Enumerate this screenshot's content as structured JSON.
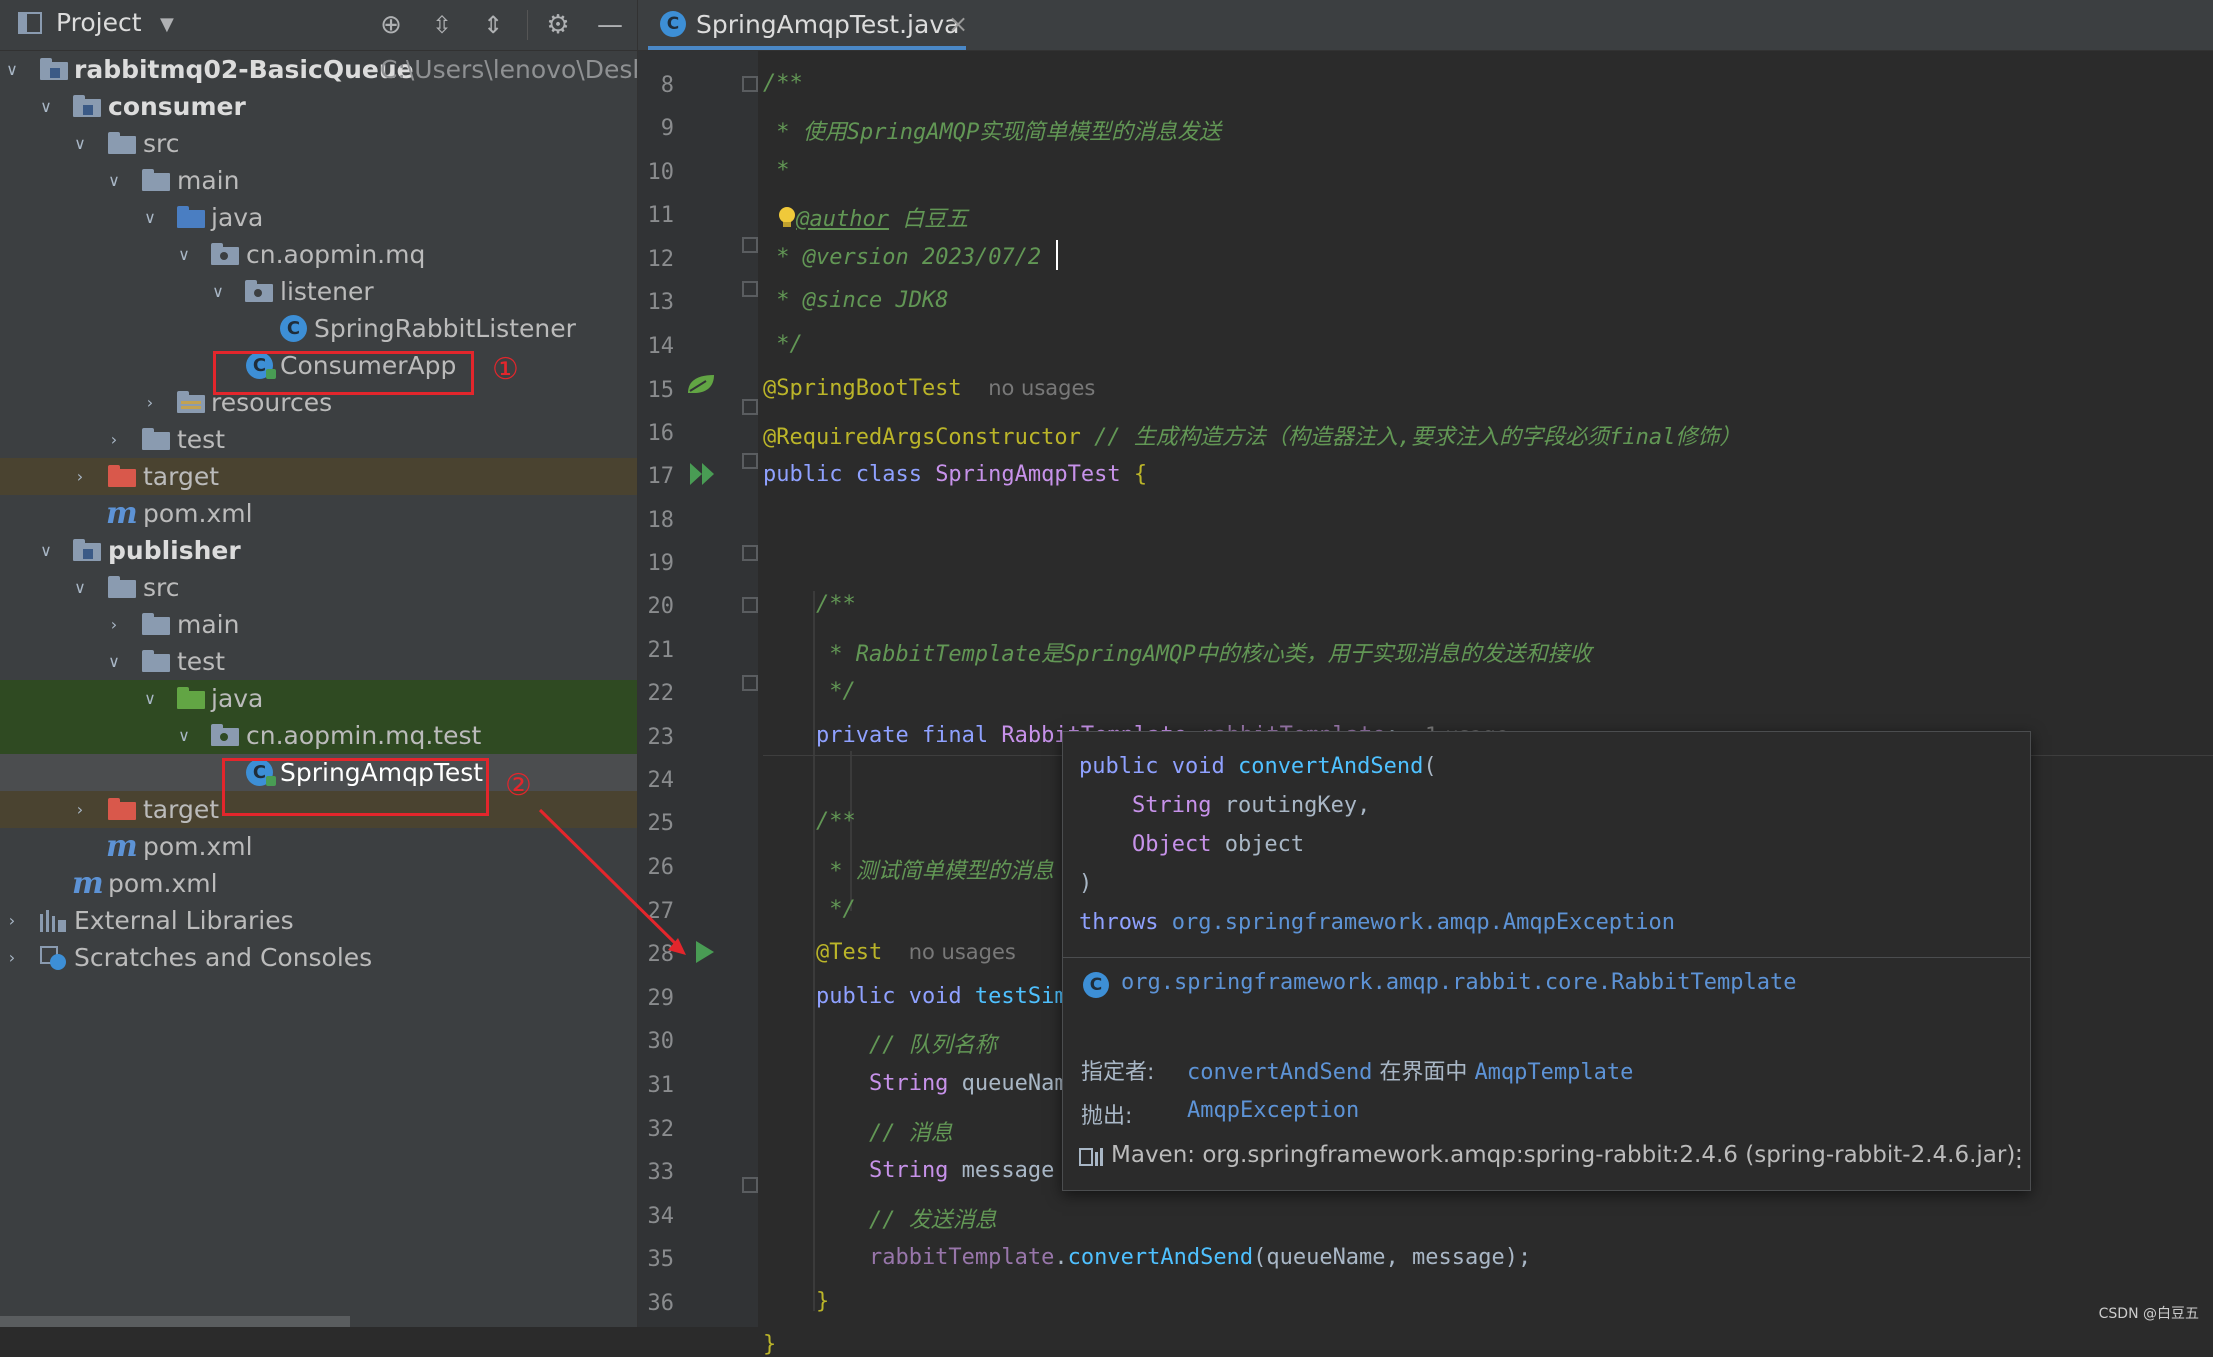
{
  "project_panel": {
    "title": "Project",
    "root_name": "rabbitmq02-BasicQueue",
    "root_path": "C:\\Users\\lenovo\\Deskt",
    "tree": {
      "consumer": "consumer",
      "consumer_src": "src",
      "consumer_main": "main",
      "consumer_java": "java",
      "consumer_pkg": "cn.aopmin.mq",
      "consumer_listener": "listener",
      "listener_class": "SpringRabbitListener",
      "consumer_app": "ConsumerApp",
      "consumer_resources": "resources",
      "consumer_test": "test",
      "consumer_target": "target",
      "consumer_pom": "pom.xml",
      "publisher": "publisher",
      "publisher_src": "src",
      "publisher_main": "main",
      "publisher_test": "test",
      "publisher_java": "java",
      "publisher_pkg": "cn.aopmin.mq.test",
      "publisher_test_class": "SpringAmqpTest",
      "publisher_target": "target",
      "publisher_pom": "pom.xml",
      "root_pom": "pom.xml",
      "external_libraries": "External Libraries",
      "scratches": "Scratches and Consoles"
    },
    "marker_1": "①",
    "marker_2": "②"
  },
  "editor": {
    "tab_title": "SpringAmqpTest.java",
    "tab_close": "×",
    "line_numbers": [
      "8",
      "9",
      "10",
      "11",
      "12",
      "13",
      "14",
      "15",
      "16",
      "17",
      "18",
      "19",
      "20",
      "21",
      "22",
      "23",
      "24",
      "25",
      "26",
      "27",
      "28",
      "29",
      "30",
      "31",
      "32",
      "33",
      "34",
      "35",
      "36"
    ],
    "lines": {
      "l8": "/**",
      "l9": " * 使用SpringAMQP实现简单模型的消息发送",
      "l10": " *",
      "l11_tag": "@author",
      "l11_val": " 白豆五",
      "l12_star": " * ",
      "l12_tag": "@version",
      "l12_val": " 2023/07/2",
      "l13_star": " * ",
      "l13_tag": "@since",
      "l13_val": " JDK8",
      "l14": " */",
      "l15_ann": "@SpringBootTest",
      "l15_hint": "no usages",
      "l16_ann": "@RequiredArgsConstructor",
      "l16_cm": " // 生成构造方法（构造器注入,要求注入的字段必须final修饰）",
      "l17_kw": "public class ",
      "l17_name": "SpringAmqpTest",
      "l17_rest": " {",
      "l19": "    /**",
      "l20": "     * RabbitTemplate是SpringAMQP中的核心类，用于实现消息的发送和接收",
      "l21": "     */",
      "l22_kw": "    private final ",
      "l22_type": "RabbitTemplate",
      "l22_field": " rabbitTemplate",
      "l22_end": ";",
      "l22_hint": "1 usage",
      "l24": "    /**",
      "l25": "     * 测试简单模型的消息",
      "l26": "     */",
      "l27_ann": "    @Test",
      "l27_hint": "no usages",
      "l28_kw": "    public void ",
      "l28_name": "testSim",
      "l29": "        // 队列名称",
      "l30_type": "        String",
      "l30_rest": " queueNam",
      "l31": "        // 消息",
      "l32_type": "        String",
      "l32_rest": " message",
      "l33": "        // 发送消息",
      "l34_field": "        rabbitTemplate",
      "l34_dot": ".",
      "l34_method": "convertAndSend",
      "l34_args": "(queueName, message);",
      "l35": "    }",
      "l36": "}"
    }
  },
  "popup": {
    "sig_line1_kw": "public void ",
    "sig_line1_name": "convertAndSend",
    "sig_line1_paren": "(",
    "sig_line2_type": "    String",
    "sig_line2_param": " routingKey,",
    "sig_line3_type": "    Object",
    "sig_line3_param": " object",
    "sig_line4": ")",
    "sig_line5_kw": "throws ",
    "sig_line5_exc": "org.springframework.amqp.AmqpException",
    "class_fqn": "org.springframework.amqp.rabbit.core.RabbitTemplate",
    "specified_label": "指定者:",
    "specified_method": "convertAndSend",
    "specified_mid": " 在界面中 ",
    "specified_iface": "AmqpTemplate",
    "throws_label": "抛出:",
    "throws_value": "AmqpException",
    "maven": "Maven: org.springframework.amqp:spring-rabbit:2.4.6 (spring-rabbit-2.4.6.jar)",
    "more": "⋮"
  },
  "watermark": "CSDN @白豆五",
  "icons": {
    "locate": "crosshair-icon",
    "expand": "expand-all-icon",
    "collapse": "collapse-all-icon",
    "settings": "gear-icon",
    "hide": "minimize-icon"
  },
  "colors": {
    "annotation_red": "#e3262c",
    "java_class_blue": "#3d8fd6",
    "run_green": "#499c54"
  }
}
